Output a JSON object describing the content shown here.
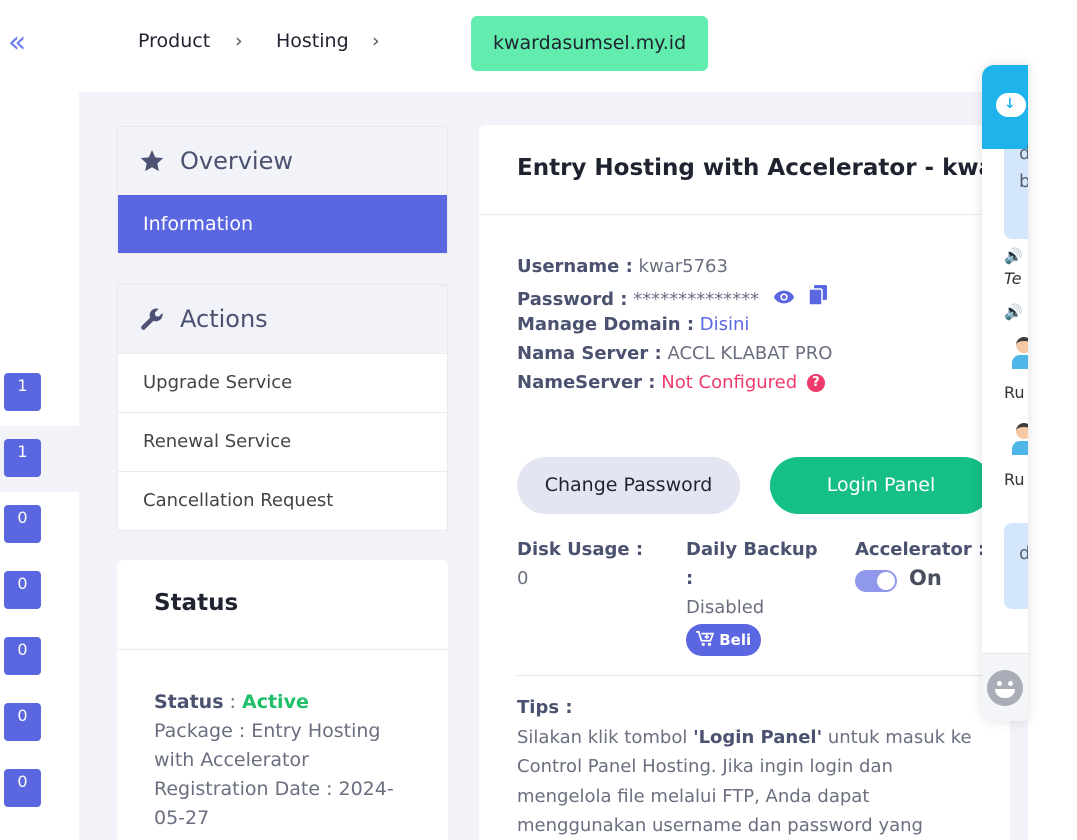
{
  "sidebar": {
    "collapse_glyph": "«",
    "badges": [
      "1",
      "1",
      "0",
      "0",
      "0",
      "0",
      "0"
    ]
  },
  "breadcrumb": {
    "items": [
      "Product",
      "Hosting"
    ],
    "separator": "›",
    "active": "kwardasumsel.my.id"
  },
  "overview": {
    "title": "Overview",
    "icon": "star-icon",
    "active_item": "Information"
  },
  "actions": {
    "title": "Actions",
    "icon": "wrench-icon",
    "items": [
      "Upgrade Service",
      "Renewal Service",
      "Cancellation Request"
    ]
  },
  "status_panel": {
    "title": "Status",
    "status_label": "Status",
    "status_sep": " : ",
    "status_value": "Active",
    "package_line": "Package : Entry Hosting with Accelerator",
    "registration_line": "Registration Date : 2024-05-27"
  },
  "card": {
    "title": "Entry Hosting with Accelerator - kwardasumsel.my.id",
    "username_label": "Username :",
    "username_value": "kwar5763",
    "password_label": "Password :",
    "password_value": "**************",
    "manage_domain_label": "Manage Domain :",
    "manage_domain_value": "Disini",
    "server_label": "Nama Server :",
    "server_value": "ACCL KLABAT PRO",
    "nameserver_label": "NameServer :",
    "nameserver_value": "Not Configured",
    "change_password": "Change Password",
    "login_panel": "Login Panel",
    "disk_label": "Disk Usage :",
    "disk_value": "0",
    "backup_label": "Daily Backup",
    "backup_colon": ":",
    "backup_value": "Disabled",
    "buy_label": "Beli",
    "accelerator_label": "Accelerator :",
    "accelerator_value": "On",
    "tips_label": "Tips :",
    "tips_pre": "Silakan klik tombol ",
    "tips_bold": "'Login Panel'",
    "tips_post": " untuk masuk ke Control Panel Hosting. Jika ingin login dan mengelola file melalui FTP, Anda dapat menggunakan username dan password yang"
  },
  "chat": {
    "bubble1_lines": [
      "d",
      "b"
    ],
    "te_text": "Te",
    "ru_text": "Ru",
    "bubble2_text": "d"
  },
  "colors": {
    "accent": "#5b67e0",
    "success": "#15bf86",
    "danger": "#ef3b6b",
    "breadcrumb_active": "#62ecad",
    "chat_header": "#1eb3ea"
  }
}
